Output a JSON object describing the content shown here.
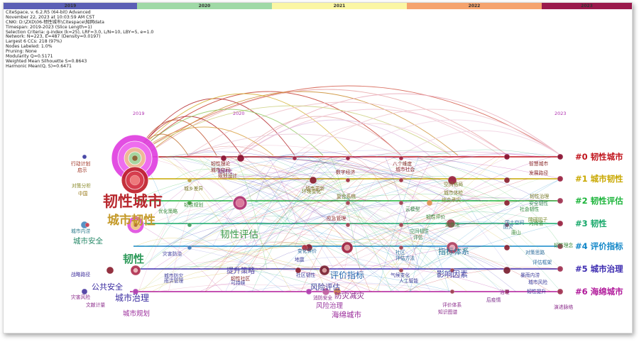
{
  "timezone_bar": [
    {
      "label": "2019",
      "color": "#5b5fb5"
    },
    {
      "label": "2020",
      "color": "#9fd9a6"
    },
    {
      "label": "2021",
      "color": "#fbf6a4"
    },
    {
      "label": "2022",
      "color": "#f5a36e"
    },
    {
      "label": "2023",
      "color": "#9a1a4c"
    }
  ],
  "info_lines": [
    "CiteSpace, v. 6.2.R5 (64-bit) Advanced",
    "November 22, 2023 at 10:03:59 AM CST",
    "CNKI: D:\\ZXD\\06-韧性城市\\Citespace\\知网data",
    "Timespan: 2019-2023 (Slice Length=1)",
    "Selection Criteria: g-index (k=25), LRF=3.0, L/N=10, LBY=5, e=1.0",
    "Network: N=223, E=487 (Density=0.0197)",
    "Largest 6 CCs: 218 (97%)",
    "Nodes Labeled: 1.0%",
    "Pruning: None",
    "Modularity Q=0.5171",
    "Weighted Mean Silhouette S=0.8643",
    "Harmonic Mean(Q, S)=0.6471"
  ],
  "year_marks": [
    "2019",
    "2020",
    "2023"
  ],
  "clusters": [
    {
      "label": "#0 韧性城市",
      "color": "#c0141c"
    },
    {
      "label": "#1 城市韧性",
      "color": "#c9a800"
    },
    {
      "label": "#2 韧性评估",
      "color": "#1bb43a"
    },
    {
      "label": "#3 韧性",
      "color": "#17a86a"
    },
    {
      "label": "#4 评价指标",
      "color": "#1287c8"
    },
    {
      "label": "#5 城市治理",
      "color": "#3c2bb0"
    },
    {
      "label": "#6 海绵城市",
      "color": "#b0189a"
    }
  ],
  "big_keywords": [
    {
      "text": "韧性城市",
      "color": "#b8282e"
    },
    {
      "text": "城市韧性",
      "color": "#c59a2a"
    },
    {
      "text": "韧性",
      "color": "#2e9a5a"
    },
    {
      "text": "韧性评估",
      "color": "#3a9a4a"
    },
    {
      "text": "城市治理",
      "color": "#3a2ca0"
    },
    {
      "text": "评价指标",
      "color": "#2a6ab0"
    },
    {
      "text": "指标体系",
      "color": "#2a7a9a"
    },
    {
      "text": "影响因素",
      "color": "#3a3aa0"
    },
    {
      "text": "公共安全",
      "color": "#3a2ca0"
    },
    {
      "text": "城市安全",
      "color": "#2a8a6a"
    },
    {
      "text": "风险评估",
      "color": "#3a3a9a"
    },
    {
      "text": "防灾减灾",
      "color": "#8a2a8a"
    },
    {
      "text": "海绵城市",
      "color": "#9a2a9a"
    },
    {
      "text": "提升策略",
      "color": "#4a3aa0"
    },
    {
      "text": "风险治理",
      "color": "#9a3aa0"
    },
    {
      "text": "城市规划",
      "color": "#9a2a9a"
    }
  ],
  "small_keywords": [
    {
      "text": "行动计划",
      "color": "#9a2a1a"
    },
    {
      "text": "启示",
      "color": "#9a2a1a"
    },
    {
      "text": "对策分析",
      "color": "#8a8a2a"
    },
    {
      "text": "中国",
      "color": "#9a7a1a"
    },
    {
      "text": "城市内涝",
      "color": "#2a7a8a"
    },
    {
      "text": "战略路径",
      "color": "#3a2a9a"
    },
    {
      "text": "灾害风险",
      "color": "#8a2a8a"
    },
    {
      "text": "文献计量",
      "color": "#8a2a8a"
    },
    {
      "text": "韧性理论",
      "color": "#8a2a2a"
    },
    {
      "text": "城市空间",
      "color": "#8a2a2a"
    },
    {
      "text": "数字经济",
      "color": "#8a2a2a"
    },
    {
      "text": "城市更新",
      "color": "#8a6a2a"
    },
    {
      "text": "八个维度",
      "color": "#8a2a2a"
    },
    {
      "text": "城市社会",
      "color": "#8a2a2a"
    },
    {
      "text": "智慧城市",
      "color": "#8a2a2a"
    },
    {
      "text": "发展路径",
      "color": "#8a2a2a"
    },
    {
      "text": "环境变化",
      "color": "#7a7a2a"
    },
    {
      "text": "复合系统",
      "color": "#7a7a2a"
    },
    {
      "text": "空间格局",
      "color": "#7a7a2a"
    },
    {
      "text": "韧性治理",
      "color": "#7a7a2a"
    },
    {
      "text": "综合承灾",
      "color": "#8a8a2a"
    },
    {
      "text": "社会韧性",
      "color": "#2a8a3a"
    },
    {
      "text": "云模型",
      "color": "#2a7a3a"
    },
    {
      "text": "障碍因子",
      "color": "#7a8a2a"
    },
    {
      "text": "城乡差异",
      "color": "#7a7a2a"
    },
    {
      "text": "韧性评价",
      "color": "#3a8a3a"
    },
    {
      "text": "优化策略",
      "color": "#3a8a3a"
    },
    {
      "text": "熵值法",
      "color": "#3a8a3a"
    },
    {
      "text": "河南省",
      "color": "#3a8a3a"
    },
    {
      "text": "空间韧性",
      "color": "#3a8a5a"
    },
    {
      "text": "评估",
      "color": "#3a8a5a"
    },
    {
      "text": "韧性规划",
      "color": "#3a8a3a"
    },
    {
      "text": "唐山",
      "color": "#3a8a3a"
    },
    {
      "text": "韧性理念",
      "color": "#3a8a3a"
    },
    {
      "text": "社区",
      "color": "#2a6aa0"
    },
    {
      "text": "评估方法",
      "color": "#2a6a9a"
    },
    {
      "text": "对策思路",
      "color": "#2a6a9a"
    },
    {
      "text": "评估框架",
      "color": "#2a6aa0"
    },
    {
      "text": "变化评价",
      "color": "#2a6aa0"
    },
    {
      "text": "地震",
      "color": "#3a3a9a"
    },
    {
      "text": "社区韧性",
      "color": "#3a3a9a"
    },
    {
      "text": "气候变化",
      "color": "#3a3a9a"
    },
    {
      "text": "人工智能",
      "color": "#3a3a9a"
    },
    {
      "text": "暴雨内涝",
      "color": "#3a3a9a"
    },
    {
      "text": "城市风险",
      "color": "#3a3a9a"
    },
    {
      "text": "韧性提升",
      "color": "#3a3a9a"
    },
    {
      "text": "消防安全",
      "color": "#8a2a8a"
    },
    {
      "text": "评价体系",
      "color": "#8a2a8a"
    },
    {
      "text": "知识图谱",
      "color": "#8a2a8a"
    },
    {
      "text": "演进脉络",
      "color": "#8a2a8a"
    },
    {
      "text": "治理",
      "color": "#8a2a8a"
    },
    {
      "text": "后疫情",
      "color": "#7a2a8a"
    },
    {
      "text": "新时代",
      "color": "#8a2a8a"
    },
    {
      "text": "规划设计",
      "color": "#8a2a2a"
    },
    {
      "text": "应急管理",
      "color": "#8a2a2a"
    },
    {
      "text": "韧性社区",
      "color": "#8a2a2a"
    },
    {
      "text": "可持续",
      "color": "#3a3a9a"
    },
    {
      "text": "灾害防治",
      "color": "#3a3a9a"
    },
    {
      "text": "城市防灾",
      "color": "#3a3a9a"
    },
    {
      "text": "雨洪管理",
      "color": "#3a3a9a"
    },
    {
      "text": "城市体检",
      "color": "#7a7a2a"
    },
    {
      "text": "安全韧性",
      "color": "#3a8a5a"
    },
    {
      "text": "国土空间",
      "color": "#2a6a9a"
    },
    {
      "text": "防灾",
      "color": "#2a6a9a"
    }
  ]
}
